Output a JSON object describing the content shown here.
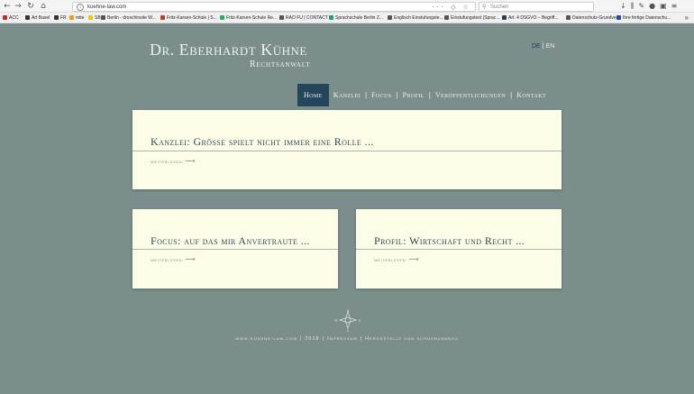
{
  "browser": {
    "url": "kuehne-law.com",
    "search_placeholder": "Suchen",
    "bookmarks": [
      {
        "label": "ACC",
        "color": "#c62828"
      },
      {
        "label": "Art Basel",
        "color": "#333333"
      },
      {
        "label": "FR",
        "color": "#333333"
      },
      {
        "label": "mite",
        "color": "#f39c12"
      },
      {
        "label": "SB",
        "color": "#f1c40f"
      },
      {
        "label": "Berlin - droschinsite W...",
        "color": "#555555"
      },
      {
        "label": "Fritz-Karsen-Schule | S...",
        "color": "#c0392b"
      },
      {
        "label": "Fritz-Karsen-Schule Re...",
        "color": "#27ae60"
      },
      {
        "label": "RAO FU | CONTACT",
        "color": "#555555"
      },
      {
        "label": "Sprachschule Berlin Z...",
        "color": "#16a085"
      },
      {
        "label": "Englisch Einstufungste...",
        "color": "#555555"
      },
      {
        "label": "Einstufungstest (Sprac...",
        "color": "#555555"
      },
      {
        "label": "Art. 4 DSGVO – Begriff...",
        "color": "#2c3e50"
      },
      {
        "label": "Datenschutz-Grundver...",
        "color": "#555555"
      },
      {
        "label": "Ihre fertige Datenschu...",
        "color": "#1f4aa8"
      }
    ]
  },
  "site": {
    "title": "Dr. Eberhardt Kühne",
    "subtitle": "Rechtsanwalt",
    "lang_de": "DE",
    "lang_sep": "|",
    "lang_en": "EN"
  },
  "nav": {
    "items": [
      {
        "label": "Home",
        "active": true
      },
      {
        "label": "Kanzlei",
        "active": false
      },
      {
        "label": "Focus",
        "active": false
      },
      {
        "label": "Profil",
        "active": false
      },
      {
        "label": "Veröffentlichungen",
        "active": false
      },
      {
        "label": "Kontakt",
        "active": false
      }
    ],
    "separator": "|"
  },
  "cards": [
    {
      "title": "Kanzlei: Grösse spielt nicht immer eine Rolle ...",
      "more": "weiterlesen"
    },
    {
      "title": "Focus: auf das mir Anvertraute ...",
      "more": "weiterlesen"
    },
    {
      "title": "Profil: Wirtschaft und Recht ...",
      "more": "weiterlesen"
    }
  ],
  "footer": {
    "site": "www.kuehne-law.com",
    "year": "2018",
    "impressum": "Impressum",
    "credit": "Hergestellt von schoenundneu",
    "separator": "|"
  },
  "compass": {
    "n": "N",
    "s": "S",
    "w": "W",
    "e": "E"
  },
  "colors": {
    "background": "#7b8e8c",
    "card": "#fdfde7",
    "nav_active": "#24465a",
    "title": "#2d4a5c"
  }
}
